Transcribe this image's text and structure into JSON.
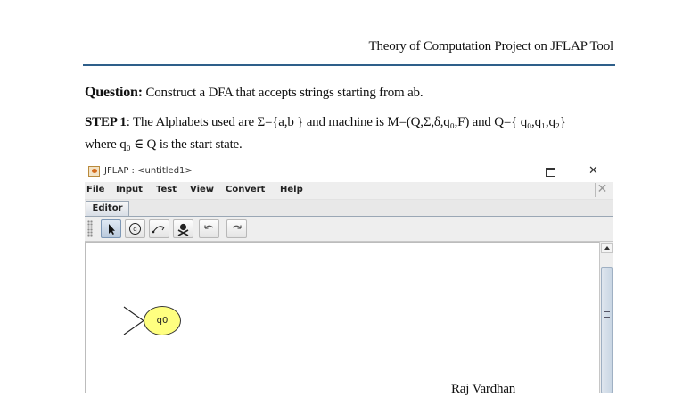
{
  "header": {
    "title": "Theory of Computation Project on JFLAP Tool"
  },
  "question": {
    "label": "Question:",
    "text": "Construct a DFA that accepts strings starting from ab."
  },
  "step1": {
    "label": "STEP 1",
    "text": ": The Alphabets used are Σ={a,b } and machine is M=(Q,Σ,δ,q₀,F) and Q={ q₀,q₁,q₂}",
    "line2": "where q₀ ∈ Q is the start state."
  },
  "jflap": {
    "title": "JFLAP : <untitled1>",
    "menu": [
      "File",
      "Input",
      "Test",
      "View",
      "Convert",
      "Help"
    ],
    "tab": "Editor",
    "tools": [
      "attribute-editor-icon",
      "state-creator-icon",
      "transition-creator-icon",
      "deleter-icon",
      "undo-icon",
      "redo-icon"
    ],
    "state": {
      "label": "q0",
      "fill": "#ffff80",
      "initial": true
    }
  },
  "footer": {
    "author": "Raj Vardhan"
  }
}
